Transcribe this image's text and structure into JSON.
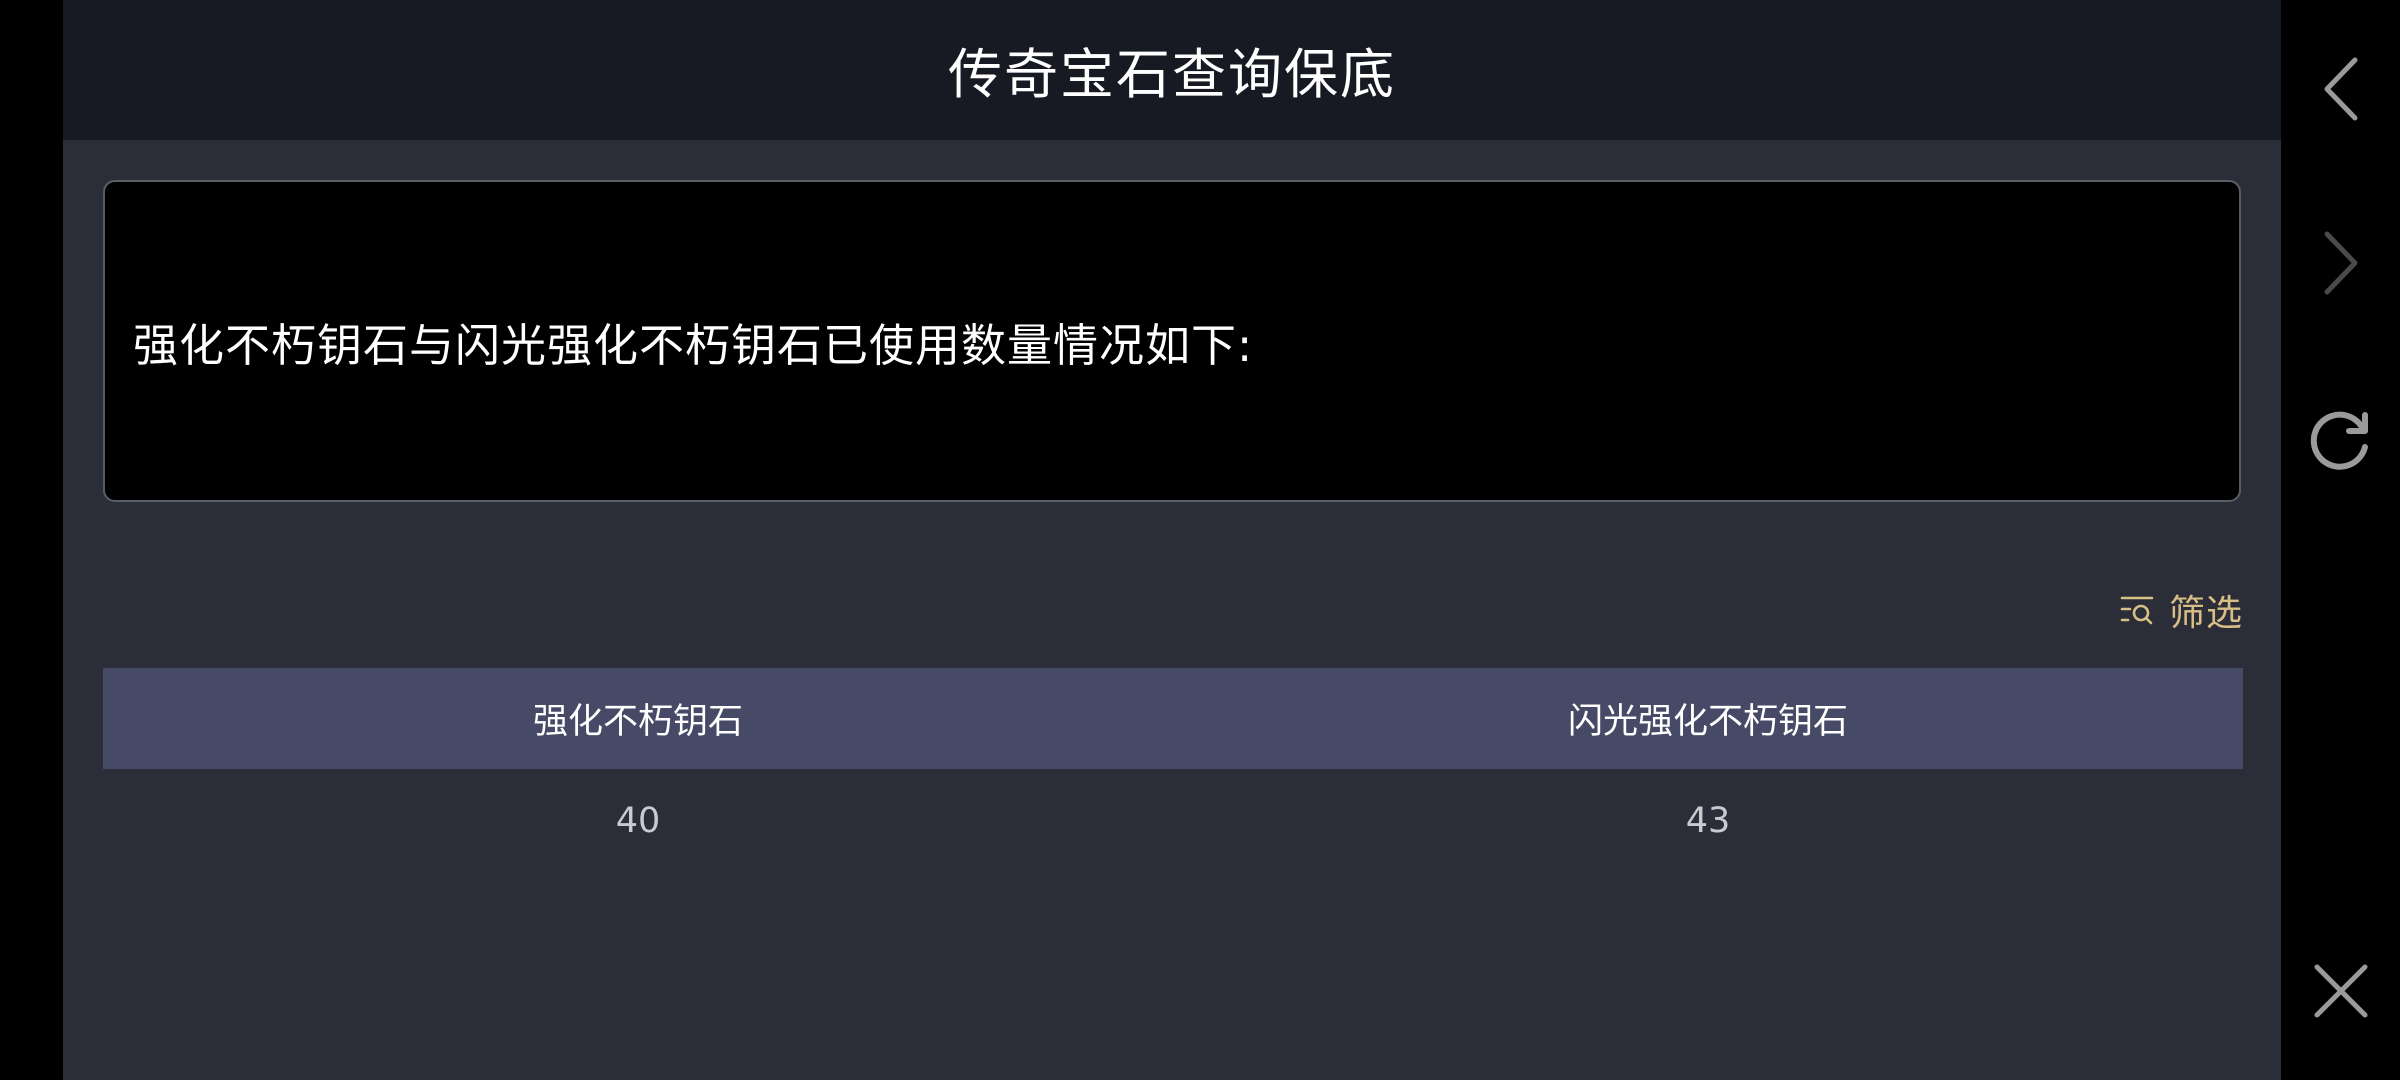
{
  "header": {
    "title": "传奇宝石查询保底"
  },
  "info": {
    "text": "强化不朽钥石与闪光强化不朽钥石已使用数量情况如下:"
  },
  "filter": {
    "label": "筛选",
    "icon": "filter-search-icon"
  },
  "table": {
    "columns": [
      "强化不朽钥石",
      "闪光强化不朽钥石"
    ],
    "rows": [
      [
        "40",
        "43"
      ]
    ]
  },
  "side_nav": {
    "back_icon": "chevron-left-icon",
    "forward_icon": "chevron-right-icon",
    "refresh_icon": "refresh-icon",
    "close_icon": "close-icon"
  },
  "colors": {
    "header_bg": "#181a23",
    "panel_bg": "#2b2d38",
    "table_head_bg": "#474a67",
    "filter_accent": "#d8bf86"
  }
}
